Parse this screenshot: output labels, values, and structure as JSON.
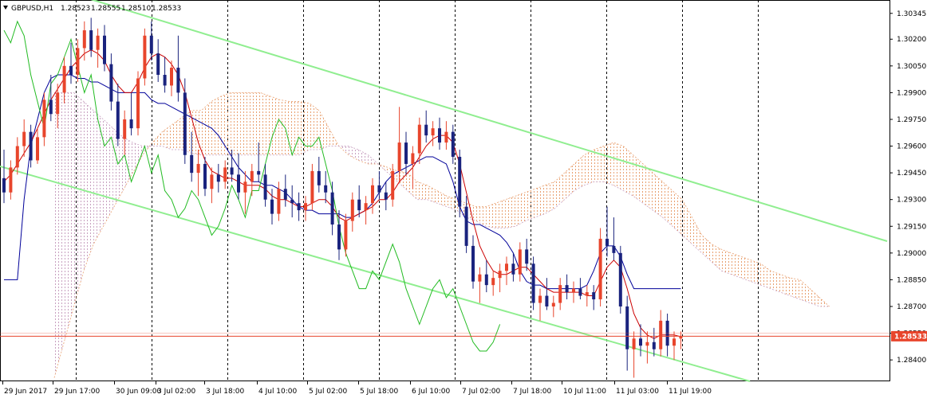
{
  "window": {
    "symbol_label": "GBPUSD,H1",
    "ohlc": [
      "1.28523",
      "1.28555",
      "1.28510",
      "1.28533"
    ]
  },
  "current_price": {
    "value": 1.28533,
    "label": "1.28533",
    "color": "#e8452c"
  },
  "colors": {
    "bull_candle": "#e8452c",
    "bear_candle": "#1a237e",
    "tenkan": "#cc0000",
    "kijun": "#000099",
    "chikou": "#22bb22",
    "cloud_up": "#e8a070",
    "cloud_down": "#c8a0c0",
    "channel": "#90ee90"
  },
  "chart_data": {
    "type": "candlestick",
    "instrument": "GBPUSD",
    "timeframe": "H1",
    "ylim": [
      1.2828,
      1.3042
    ],
    "y_ticks": [
      "1.30345",
      "1.30200",
      "1.30050",
      "1.29900",
      "1.29750",
      "1.29600",
      "1.29450",
      "1.29300",
      "1.29150",
      "1.29000",
      "1.28850",
      "1.28700",
      "1.28550",
      "1.28400"
    ],
    "x_ticks": [
      "29 Jun 2017",
      "29 Jun 17:00",
      "30 Jun 09:00",
      "3 Jul 02:00",
      "3 Jul 18:00",
      "4 Jul 10:00",
      "5 Jul 02:00",
      "5 Jul 18:00",
      "6 Jul 10:00",
      "7 Jul 02:00",
      "7 Jul 18:00",
      "10 Jul 11:00",
      "11 Jul 03:00",
      "11 Jul 19:00"
    ],
    "grid": "vertical dashed at x ticks",
    "candles": [
      [
        1.2942,
        1.2958,
        1.2928,
        1.2934
      ],
      [
        1.2934,
        1.2952,
        1.293,
        1.2948
      ],
      [
        1.2948,
        1.2965,
        1.2944,
        1.296
      ],
      [
        1.296,
        1.2975,
        1.2954,
        1.2968
      ],
      [
        1.2968,
        1.2972,
        1.2948,
        1.2952
      ],
      [
        1.2952,
        1.297,
        1.295,
        1.2965
      ],
      [
        1.2965,
        1.299,
        1.296,
        1.2986
      ],
      [
        1.2986,
        1.3,
        1.2974,
        1.2978
      ],
      [
        1.2978,
        1.2995,
        1.297,
        1.299
      ],
      [
        1.299,
        1.301,
        1.2984,
        1.3005
      ],
      [
        1.3005,
        1.3018,
        1.2995,
        1.3
      ],
      [
        1.3,
        1.302,
        1.2996,
        1.3015
      ],
      [
        1.3015,
        1.303,
        1.3008,
        1.3025
      ],
      [
        1.3025,
        1.3032,
        1.301,
        1.3014
      ],
      [
        1.3014,
        1.3026,
        1.3004,
        1.3022
      ],
      [
        1.3022,
        1.3028,
        1.3002,
        1.3006
      ],
      [
        1.3006,
        1.3012,
        1.298,
        1.2985
      ],
      [
        1.2985,
        1.2995,
        1.296,
        1.2964
      ],
      [
        1.2964,
        1.298,
        1.2955,
        1.2975
      ],
      [
        1.2975,
        1.299,
        1.2966,
        1.297
      ],
      [
        1.297,
        1.3002,
        1.2966,
        1.2998
      ],
      [
        1.2998,
        1.3026,
        1.2994,
        1.3022
      ],
      [
        1.3022,
        1.303,
        1.3008,
        1.3012
      ],
      [
        1.3012,
        1.302,
        1.2996,
        1.3
      ],
      [
        1.3,
        1.301,
        1.299,
        1.2994
      ],
      [
        1.2994,
        1.3008,
        1.2988,
        1.3004
      ],
      [
        1.3004,
        1.3022,
        1.2985,
        1.299
      ],
      [
        1.299,
        1.2998,
        1.295,
        1.2955
      ],
      [
        1.2955,
        1.2968,
        1.294,
        1.2945
      ],
      [
        1.2945,
        1.2958,
        1.2932,
        1.295
      ],
      [
        1.295,
        1.2954,
        1.2932,
        1.2936
      ],
      [
        1.2936,
        1.2948,
        1.2928,
        1.2944
      ],
      [
        1.2944,
        1.295,
        1.2934,
        1.294
      ],
      [
        1.294,
        1.2952,
        1.2936,
        1.2948
      ],
      [
        1.2948,
        1.2958,
        1.294,
        1.2944
      ],
      [
        1.2944,
        1.2956,
        1.293,
        1.2934
      ],
      [
        1.2934,
        1.2946,
        1.2922,
        1.294
      ],
      [
        1.294,
        1.295,
        1.2932,
        1.2946
      ],
      [
        1.2946,
        1.2962,
        1.294,
        1.2944
      ],
      [
        1.2944,
        1.295,
        1.2926,
        1.293
      ],
      [
        1.293,
        1.2936,
        1.2916,
        1.2922
      ],
      [
        1.2922,
        1.294,
        1.2918,
        1.2936
      ],
      [
        1.2936,
        1.2944,
        1.2926,
        1.293
      ],
      [
        1.293,
        1.2938,
        1.292,
        1.2928
      ],
      [
        1.2928,
        1.2934,
        1.2918,
        1.2924
      ],
      [
        1.2924,
        1.2932,
        1.2918,
        1.2928
      ],
      [
        1.2928,
        1.295,
        1.2924,
        1.2946
      ],
      [
        1.2946,
        1.2954,
        1.2934,
        1.2938
      ],
      [
        1.2938,
        1.2946,
        1.2928,
        1.2934
      ],
      [
        1.2934,
        1.294,
        1.291,
        1.2916
      ],
      [
        1.2916,
        1.2924,
        1.2896,
        1.2902
      ],
      [
        1.2902,
        1.2922,
        1.2898,
        1.2918
      ],
      [
        1.2918,
        1.2934,
        1.2912,
        1.293
      ],
      [
        1.293,
        1.2938,
        1.292,
        1.2924
      ],
      [
        1.2924,
        1.2932,
        1.2916,
        1.2928
      ],
      [
        1.2928,
        1.2942,
        1.2922,
        1.2938
      ],
      [
        1.2938,
        1.2946,
        1.293,
        1.2934
      ],
      [
        1.2934,
        1.294,
        1.2924,
        1.293
      ],
      [
        1.293,
        1.295,
        1.2926,
        1.2946
      ],
      [
        1.2946,
        1.2982,
        1.294,
        1.2962
      ],
      [
        1.2962,
        1.2968,
        1.2944,
        1.295
      ],
      [
        1.295,
        1.296,
        1.2936,
        1.2956
      ],
      [
        1.2956,
        1.2976,
        1.295,
        1.2972
      ],
      [
        1.2972,
        1.298,
        1.2962,
        1.2966
      ],
      [
        1.2966,
        1.2974,
        1.296,
        1.297
      ],
      [
        1.297,
        1.2976,
        1.2958,
        1.2962
      ],
      [
        1.2962,
        1.2974,
        1.2958,
        1.2968
      ],
      [
        1.2968,
        1.2972,
        1.295,
        1.2954
      ],
      [
        1.2954,
        1.2958,
        1.292,
        1.2926
      ],
      [
        1.2926,
        1.2932,
        1.29,
        1.2904
      ],
      [
        1.2904,
        1.291,
        1.288,
        1.2884
      ],
      [
        1.2884,
        1.2892,
        1.2872,
        1.2888
      ],
      [
        1.2888,
        1.2896,
        1.2878,
        1.2882
      ],
      [
        1.2882,
        1.289,
        1.2876,
        1.2886
      ],
      [
        1.2886,
        1.2894,
        1.2878,
        1.289
      ],
      [
        1.289,
        1.2898,
        1.2882,
        1.2894
      ],
      [
        1.2894,
        1.29,
        1.2884,
        1.2888
      ],
      [
        1.2888,
        1.2906,
        1.2884,
        1.2902
      ],
      [
        1.2902,
        1.2908,
        1.289,
        1.2894
      ],
      [
        1.2894,
        1.2898,
        1.2868,
        1.2872
      ],
      [
        1.2872,
        1.288,
        1.2862,
        1.2876
      ],
      [
        1.2876,
        1.2886,
        1.2868,
        1.287
      ],
      [
        1.287,
        1.2876,
        1.2864,
        1.2872
      ],
      [
        1.2872,
        1.2886,
        1.2868,
        1.2882
      ],
      [
        1.2882,
        1.2888,
        1.2874,
        1.2878
      ],
      [
        1.2878,
        1.2884,
        1.2872,
        1.288
      ],
      [
        1.288,
        1.2886,
        1.2874,
        1.2876
      ],
      [
        1.2876,
        1.2882,
        1.287,
        1.2878
      ],
      [
        1.2878,
        1.2882,
        1.2868,
        1.2874
      ],
      [
        1.2874,
        1.2914,
        1.287,
        1.2908
      ],
      [
        1.2908,
        1.2926,
        1.2898,
        1.2904
      ],
      [
        1.2904,
        1.292,
        1.2896,
        1.29
      ],
      [
        1.29,
        1.2904,
        1.2866,
        1.287
      ],
      [
        1.287,
        1.2876,
        1.2834,
        1.2846
      ],
      [
        1.2846,
        1.2856,
        1.283,
        1.2852
      ],
      [
        1.2852,
        1.286,
        1.2842,
        1.2848
      ],
      [
        1.2848,
        1.2856,
        1.2838,
        1.285
      ],
      [
        1.285,
        1.2858,
        1.2842,
        1.2846
      ],
      [
        1.2846,
        1.2868,
        1.2842,
        1.2862
      ],
      [
        1.2862,
        1.2866,
        1.2842,
        1.2848
      ],
      [
        1.2848,
        1.2856,
        1.284,
        1.2852
      ],
      [
        1.2852,
        1.2856,
        1.2846,
        1.2853
      ]
    ],
    "tenkan": [
      1.294,
      1.2944,
      1.295,
      1.2956,
      1.2962,
      1.297,
      1.2978,
      1.2986,
      1.2992,
      1.2998,
      1.3004,
      1.3008,
      1.3012,
      1.3014,
      1.3012,
      1.3008,
      1.3,
      1.2994,
      1.299,
      1.299,
      1.2996,
      1.3004,
      1.301,
      1.3012,
      1.301,
      1.3006,
      1.3,
      1.299,
      1.2976,
      1.2962,
      1.2952,
      1.2946,
      1.2944,
      1.2942,
      1.2942,
      1.294,
      1.2938,
      1.2938,
      1.2938,
      1.2936,
      1.2932,
      1.293,
      1.293,
      1.2928,
      1.2926,
      1.2926,
      1.2928,
      1.293,
      1.293,
      1.2926,
      1.292,
      1.2918,
      1.292,
      1.2922,
      1.2924,
      1.2926,
      1.293,
      1.293,
      1.2934,
      1.294,
      1.2944,
      1.2948,
      1.2954,
      1.296,
      1.2964,
      1.2966,
      1.2966,
      1.2962,
      1.295,
      1.2934,
      1.2918,
      1.2904,
      1.2896,
      1.289,
      1.2888,
      1.2888,
      1.289,
      1.2892,
      1.2892,
      1.2888,
      1.2884,
      1.288,
      1.2878,
      1.2878,
      1.2878,
      1.2878,
      1.2878,
      1.2876,
      1.2876,
      1.2884,
      1.2892,
      1.2896,
      1.2892,
      1.288,
      1.2866,
      1.2858,
      1.2854,
      1.2852,
      1.2854,
      1.2854,
      1.2854,
      1.2853
    ],
    "kijun": [
      1.2885,
      1.2885,
      1.2885,
      1.293,
      1.296,
      1.2975,
      1.299,
      1.2998,
      1.3,
      1.3,
      1.3,
      1.2998,
      1.2998,
      1.2996,
      1.2996,
      1.2994,
      1.2992,
      1.299,
      1.299,
      1.299,
      1.299,
      1.299,
      1.2986,
      1.2984,
      1.2984,
      1.2982,
      1.298,
      1.2978,
      1.2976,
      1.2974,
      1.2972,
      1.297,
      1.2966,
      1.296,
      1.2954,
      1.2948,
      1.2944,
      1.294,
      1.294,
      1.2938,
      1.2938,
      1.2936,
      1.2934,
      1.293,
      1.2926,
      1.2924,
      1.2924,
      1.2922,
      1.2922,
      1.2922,
      1.2922,
      1.292,
      1.292,
      1.2922,
      1.2924,
      1.2928,
      1.2934,
      1.294,
      1.2944,
      1.2946,
      1.2948,
      1.295,
      1.2952,
      1.2954,
      1.2954,
      1.2952,
      1.295,
      1.294,
      1.2926,
      1.2918,
      1.2916,
      1.2916,
      1.2914,
      1.2912,
      1.291,
      1.2906,
      1.29,
      1.289,
      1.2884,
      1.2882,
      1.2882,
      1.288,
      1.288,
      1.288,
      1.288,
      1.288,
      1.288,
      1.2882,
      1.289,
      1.29,
      1.2904,
      1.2904,
      1.2898,
      1.2888,
      1.288,
      1.288,
      1.288,
      1.288,
      1.288,
      1.288,
      1.288,
      1.288
    ],
    "chikou": [
      1.3025,
      1.3018,
      1.303,
      1.3022,
      1.3,
      1.2985,
      1.297,
      1.2995,
      1.3,
      1.301,
      1.302,
      1.3005,
      1.299,
      1.3,
      1.2975,
      1.296,
      1.2965,
      1.295,
      1.2955,
      1.294,
      1.295,
      1.296,
      1.2945,
      1.2955,
      1.2935,
      1.293,
      1.292,
      1.2925,
      1.2935,
      1.293,
      1.292,
      1.291,
      1.2915,
      1.2925,
      1.2938,
      1.293,
      1.292,
      1.2935,
      1.2935,
      1.295,
      1.2965,
      1.2975,
      1.297,
      1.2955,
      1.2965,
      1.296,
      1.296,
      1.2965,
      1.295,
      1.2935,
      1.2915,
      1.29,
      1.289,
      1.288,
      1.288,
      1.289,
      1.2885,
      1.2895,
      1.2905,
      1.2895,
      1.288,
      1.287,
      1.286,
      1.287,
      1.288,
      1.2885,
      1.2875,
      1.288,
      1.287,
      1.286,
      1.285,
      1.2845,
      1.2845,
      1.285,
      1.286
    ],
    "senkou_a": [
      1.283,
      1.285,
      1.287,
      1.289,
      1.2905,
      1.2915,
      1.2925,
      1.2935,
      1.2945,
      1.2955,
      1.2962,
      1.2968,
      1.2972,
      1.2976,
      1.298,
      1.298,
      1.2985,
      1.2988,
      1.299,
      1.299,
      1.299,
      1.299,
      1.2988,
      1.2986,
      1.2985,
      1.2985,
      1.2984,
      1.298,
      1.297,
      1.296,
      1.2955,
      1.2952,
      1.295,
      1.295,
      1.2948,
      1.2946,
      1.2945,
      1.294,
      1.2938,
      1.2935,
      1.2932,
      1.293,
      1.2928,
      1.2926,
      1.2926,
      1.2928,
      1.293,
      1.2932,
      1.2934,
      1.2936,
      1.2938,
      1.294,
      1.2945,
      1.295,
      1.2955,
      1.2958,
      1.296,
      1.2962,
      1.296,
      1.2955,
      1.295,
      1.2945,
      1.294,
      1.2935,
      1.293,
      1.292,
      1.291,
      1.2905,
      1.2902,
      1.29,
      1.2898,
      1.2896,
      1.2894,
      1.289,
      1.2888,
      1.2886,
      1.2885,
      1.288,
      1.2875,
      1.287
    ],
    "senkou_b": [
      1.299,
      1.299,
      1.299,
      1.2985,
      1.298,
      1.2975,
      1.297,
      1.2965,
      1.2962,
      1.296,
      1.296,
      1.296,
      1.2958,
      1.2958,
      1.2956,
      1.2955,
      1.2955,
      1.2955,
      1.2955,
      1.2955,
      1.2955,
      1.2955,
      1.2955,
      1.2955,
      1.2955,
      1.2955,
      1.2958,
      1.2958,
      1.296,
      1.296,
      1.296,
      1.2958,
      1.2955,
      1.295,
      1.2945,
      1.294,
      1.2935,
      1.293,
      1.293,
      1.2928,
      1.2926,
      1.2924,
      1.292,
      1.2918,
      1.2915,
      1.2914,
      1.2914,
      1.2915,
      1.2918,
      1.292,
      1.2922,
      1.2925,
      1.293,
      1.2935,
      1.2938,
      1.294,
      1.294,
      1.2938,
      1.2935,
      1.2932,
      1.2928,
      1.2924,
      1.292,
      1.2915,
      1.291,
      1.2905,
      1.29,
      1.2895,
      1.289,
      1.2888,
      1.2886,
      1.2884,
      1.2882,
      1.288,
      1.2878,
      1.2876,
      1.2874,
      1.2872,
      1.287,
      1.287
    ],
    "channel": {
      "upper": [
        [
          "29 Jun 2017",
          1.304
        ],
        [
          "end",
          1.2902
        ]
      ],
      "lower": [
        [
          "29 Jun 2017",
          1.295
        ],
        [
          "end",
          1.2812
        ]
      ]
    }
  }
}
